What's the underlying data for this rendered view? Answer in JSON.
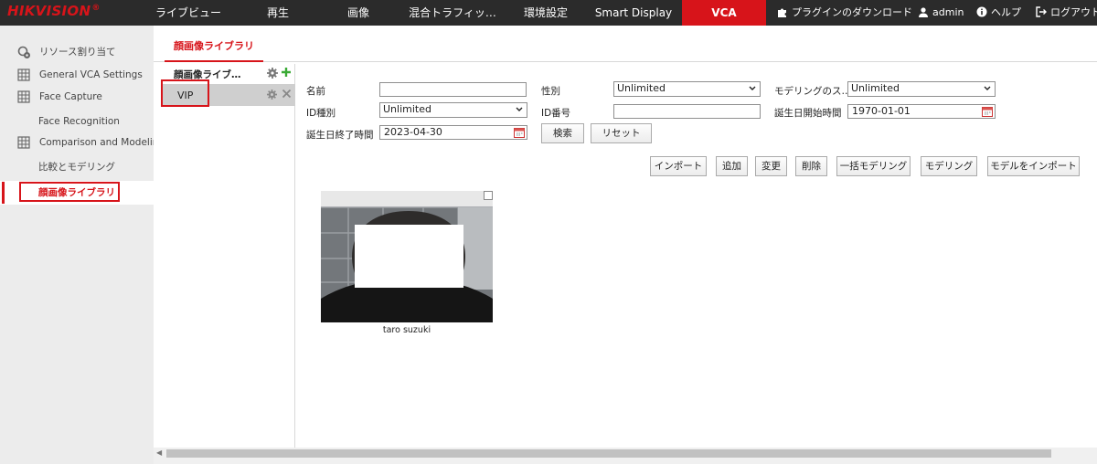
{
  "brand": {
    "name": "HIKVISION",
    "mark": "®"
  },
  "nav": [
    {
      "label": "ライブビュー"
    },
    {
      "label": "再生"
    },
    {
      "label": "画像"
    },
    {
      "label": "混合トラフィッ…"
    },
    {
      "label": "環境設定"
    },
    {
      "label": "Smart Display"
    },
    {
      "label": "VCA"
    }
  ],
  "top_tools": {
    "plugin": "プラグインのダウンロード",
    "user": "admin",
    "help": "ヘルプ",
    "logout": "ログアウト"
  },
  "sidebar": {
    "items": [
      {
        "label": "リソース割り当て",
        "icon": "resource-icon"
      },
      {
        "label": "General VCA Settings",
        "icon": "grid-icon"
      },
      {
        "label": "Face Capture",
        "icon": "grid-icon"
      },
      {
        "label": "Face Recognition"
      },
      {
        "label": "Comparison and Modeling",
        "icon": "grid-icon"
      },
      {
        "label": "比較とモデリング"
      },
      {
        "label": "顔画像ライブラリ"
      }
    ]
  },
  "tab": {
    "label": "顔画像ライブラリ"
  },
  "library_panel": {
    "header": "顔画像ライブ…",
    "item": "VIP"
  },
  "form": {
    "name_label": "名前",
    "name_value": "",
    "gender_label": "性別",
    "gender_value": "Unlimited",
    "modeling_status_label": "モデリングのス…",
    "modeling_status_value": "Unlimited",
    "id_type_label": "ID種別",
    "id_type_value": "Unlimited",
    "id_number_label": "ID番号",
    "id_number_value": "",
    "birth_start_label": "誕生日開始時間",
    "birth_start_value": "1970-01-01",
    "birth_end_label": "誕生日終了時間",
    "birth_end_value": "2023-04-30",
    "search_btn": "検索",
    "reset_btn": "リセット"
  },
  "actions": {
    "import": "インポート",
    "add": "追加",
    "modify": "変更",
    "delete": "削除",
    "batch_modeling": "一括モデリング",
    "modeling": "モデリング",
    "import_model": "モデルをインポート"
  },
  "faces": [
    {
      "name": "taro suzuki"
    }
  ],
  "colors": {
    "accent": "#d7141a",
    "topbar": "#2b2b2b",
    "sidebar": "#ececec"
  }
}
